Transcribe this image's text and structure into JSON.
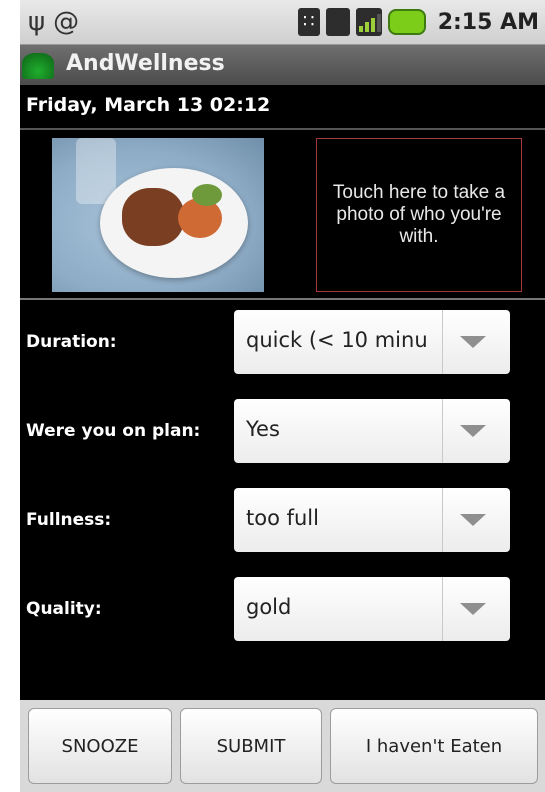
{
  "status_bar": {
    "left_icons": [
      "usb-icon",
      "at-sign-icon"
    ],
    "right_icons": [
      "bluetooth-icon",
      "wifi-icon",
      "signal-icon",
      "battery-icon"
    ],
    "time": "2:15 AM"
  },
  "app": {
    "title": "AndWellness",
    "icon": "app-leaf-icon",
    "accent_color": "#1fae2d"
  },
  "date_header": "Friday, March 13 02:12",
  "photo_section": {
    "photo_icon": "food-photo",
    "prompt_text": "Touch here to take a photo of who you're with.",
    "prompt_border_color": "#a23a3a"
  },
  "form": {
    "fields": [
      {
        "label": "Duration:",
        "value": "quick (< 10 minu"
      },
      {
        "label": "Were you on plan:",
        "value": "Yes"
      },
      {
        "label": "Fullness:",
        "value": "too full"
      },
      {
        "label": "Quality:",
        "value": "gold"
      }
    ],
    "dropdown_icon": "chevron-down-icon"
  },
  "buttons": {
    "snooze": "SNOOZE",
    "submit": "SUBMIT",
    "not_eaten": "I haven't Eaten"
  }
}
